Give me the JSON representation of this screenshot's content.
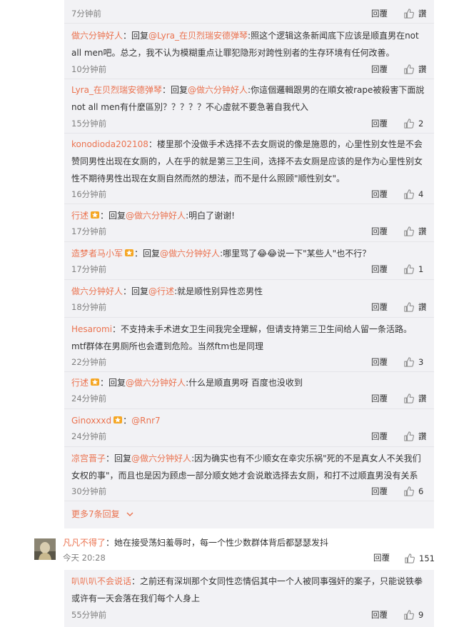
{
  "colors": {
    "accent": "#eb7350",
    "panel": "#f2f2f5",
    "muted": "#808080"
  },
  "ui": {
    "reply_label": "回覆",
    "like_zero": "讚"
  },
  "replies": [
    {
      "time": "7分钟前",
      "like": "讚"
    },
    {
      "user": "做六分钟好人",
      "reply_word": "回复",
      "reply_to": "@Lyra_在贝烈瑞安德弹琴",
      "text": ":照这个逻辑这条新闻底下应该是顺直男在not all men吧。总之，我不认为模糊重点让罪犯隐形对跨性别者的生存环境有任何改善。",
      "time": "10分钟前",
      "like": "讚"
    },
    {
      "user": "Lyra_在贝烈瑞安德弹琴",
      "reply_word": "回复",
      "reply_to": "@做六分钟好人",
      "text": ":你這個邏輯跟男的在順女被rape被殺害下面說not all men有什麼區別？？？？？不心虛就不要急著自我代入",
      "time": "15分钟前",
      "like": "2"
    },
    {
      "user": "konodioda202108",
      "text": "：楼里那个没做手术选择不去女厕说的像是施恩的，心里性别女性是不会赞同男性出现在女厕的，人在乎的就是第三卫生间，选择不去女厕是应该的是作为心里性别女性不期待男性出现在女厕自然而然的想法，而不是什么照顾\"顺性别女\"。",
      "time": "16分钟前",
      "like": "4"
    },
    {
      "user": "行述",
      "badge": "gold-badge-icon",
      "reply_word": "回复",
      "reply_to": "@做六分钟好人",
      "text": ":明白了谢谢!",
      "time": "17分钟前",
      "like": "讚"
    },
    {
      "user": "造梦者马小军",
      "badge": "gold-badge-icon",
      "reply_word": "回复",
      "reply_to": "@做六分钟好人",
      "text": ":哪里骂了😂😂说一下\"某些人\"也不行？",
      "time": "17分钟前",
      "like": "1"
    },
    {
      "user": "做六分钟好人",
      "reply_word": "回复",
      "reply_to": "@行述",
      "text": ":就是顺性别异性恋男性",
      "time": "18分钟前",
      "like": "讚"
    },
    {
      "user": "Hesaromi",
      "text": "：不支持未手术进女卫生间我完全理解，但请支持第三卫生间给人留一条活路。mtf群体在男厕所也会遭到危险。当然ftm也是同理",
      "time": "22分钟前",
      "like": "3"
    },
    {
      "user": "行述",
      "badge": "gold-badge-icon",
      "reply_word": "回复",
      "reply_to": "@做六分钟好人",
      "text": ":什么是顺直男呀 百度也没收到",
      "time": "24分钟前",
      "like": "讚"
    },
    {
      "user": "Ginoxxxd",
      "badge": "gold-badge-icon",
      "text": "：",
      "mention": "@Rnr7",
      "time": "24分钟前",
      "like": "讚"
    },
    {
      "user": "凉宫晋子",
      "reply_word": "回复",
      "reply_to": "@做六分钟好人",
      "text": ":因为确实也有不少顺女在幸灾乐祸\"死的不是真女人不关我们女权的事\"，而且也是因为顾虑一部分顺女她才会说敢选择去女厕，和打不过顺直男没有关系",
      "time": "30分钟前",
      "like": "6"
    }
  ],
  "more_replies": "更多7条回复",
  "main_comment": {
    "user": "凡凡不得了",
    "text": "：她在接受荡妇羞辱时，每一个性少数群体背后都瑟瑟发抖",
    "time": "今天 20:28",
    "like": "151"
  },
  "main_reply": {
    "user": "叭叭叭不会说话",
    "text": "：之前还有深圳那个女同性恋情侣其中一个人被同事强奸的案子，只能说铁拳或许有一天会落在我们每个人身上",
    "time": "55分钟前",
    "like": "9"
  }
}
